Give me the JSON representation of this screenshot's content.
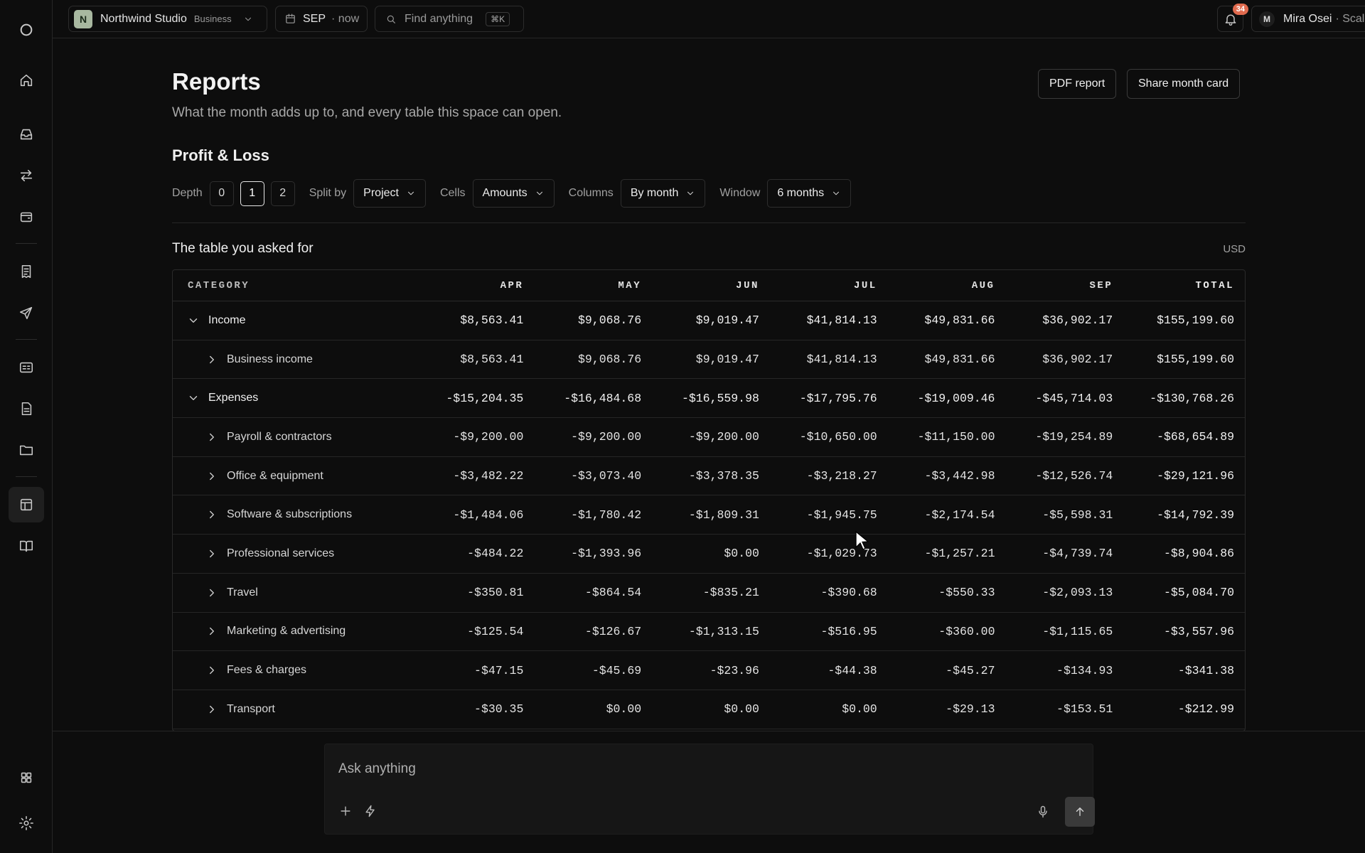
{
  "workspace": {
    "initial": "N",
    "name": "Northwind Studio",
    "plan": "Business"
  },
  "period": {
    "month": "SEP",
    "suffix": "· now"
  },
  "search": {
    "placeholder": "Find anything",
    "shortcut": "⌘K"
  },
  "notifications": {
    "count": "34"
  },
  "user": {
    "initial": "M",
    "name": "Mira Osei",
    "plan_suffix": "· Scale"
  },
  "rail": {
    "icons": [
      "logo-icon",
      "home-icon",
      "inbox-icon",
      "transfers-icon",
      "wallet-icon",
      "receipt-icon",
      "send-icon",
      "contacts-card-icon",
      "document-icon",
      "folder-icon",
      "table-icon",
      "book-icon",
      "apps-grid-icon",
      "settings-icon"
    ],
    "active": "table-icon"
  },
  "page": {
    "title": "Reports",
    "subtitle": "What the month adds up to, and every table this space can open.",
    "pdf_button": "PDF report",
    "share_button": "Share month card"
  },
  "pnl": {
    "title": "Profit & Loss",
    "depth_label": "Depth",
    "depth_options": [
      "0",
      "1",
      "2"
    ],
    "depth_selected": "1",
    "split_label": "Split by",
    "split_value": "Project",
    "cells_label": "Cells",
    "cells_value": "Amounts",
    "columns_label": "Columns",
    "columns_value": "By month",
    "window_label": "Window",
    "window_value": "6 months"
  },
  "table": {
    "title": "The table you asked for",
    "currency": "USD",
    "headers": [
      "CATEGORY",
      "APR",
      "MAY",
      "JUN",
      "JUL",
      "AUG",
      "SEP",
      "TOTAL"
    ],
    "rows": [
      {
        "label": "Income",
        "type": "group",
        "values": [
          "$8,563.41",
          "$9,068.76",
          "$9,019.47",
          "$41,814.13",
          "$49,831.66",
          "$36,902.17"
        ],
        "total": "$155,199.60"
      },
      {
        "label": "Business income",
        "type": "child",
        "values": [
          "$8,563.41",
          "$9,068.76",
          "$9,019.47",
          "$41,814.13",
          "$49,831.66",
          "$36,902.17"
        ],
        "total": "$155,199.60"
      },
      {
        "label": "Expenses",
        "type": "group",
        "values": [
          "-$15,204.35",
          "-$16,484.68",
          "-$16,559.98",
          "-$17,795.76",
          "-$19,009.46",
          "-$45,714.03"
        ],
        "total": "-$130,768.26"
      },
      {
        "label": "Payroll & contractors",
        "type": "child",
        "values": [
          "-$9,200.00",
          "-$9,200.00",
          "-$9,200.00",
          "-$10,650.00",
          "-$11,150.00",
          "-$19,254.89"
        ],
        "total": "-$68,654.89"
      },
      {
        "label": "Office & equipment",
        "type": "child",
        "values": [
          "-$3,482.22",
          "-$3,073.40",
          "-$3,378.35",
          "-$3,218.27",
          "-$3,442.98",
          "-$12,526.74"
        ],
        "total": "-$29,121.96"
      },
      {
        "label": "Software & subscriptions",
        "type": "child",
        "values": [
          "-$1,484.06",
          "-$1,780.42",
          "-$1,809.31",
          "-$1,945.75",
          "-$2,174.54",
          "-$5,598.31"
        ],
        "total": "-$14,792.39"
      },
      {
        "label": "Professional services",
        "type": "child",
        "values": [
          "-$484.22",
          "-$1,393.96",
          "$0.00",
          "-$1,029.73",
          "-$1,257.21",
          "-$4,739.74"
        ],
        "total": "-$8,904.86"
      },
      {
        "label": "Travel",
        "type": "child",
        "values": [
          "-$350.81",
          "-$864.54",
          "-$835.21",
          "-$390.68",
          "-$550.33",
          "-$2,093.13"
        ],
        "total": "-$5,084.70"
      },
      {
        "label": "Marketing & advertising",
        "type": "child",
        "values": [
          "-$125.54",
          "-$126.67",
          "-$1,313.15",
          "-$516.95",
          "-$360.00",
          "-$1,115.65"
        ],
        "total": "-$3,557.96"
      },
      {
        "label": "Fees & charges",
        "type": "child",
        "values": [
          "-$47.15",
          "-$45.69",
          "-$23.96",
          "-$44.38",
          "-$45.27",
          "-$134.93"
        ],
        "total": "-$341.38"
      },
      {
        "label": "Transport",
        "type": "child",
        "values": [
          "-$30.35",
          "$0.00",
          "$0.00",
          "$0.00",
          "-$29.13",
          "-$153.51"
        ],
        "total": "-$212.99"
      }
    ]
  },
  "chat": {
    "placeholder": "Ask anything"
  },
  "colors": {
    "background": "#0d0d0d",
    "accent_badge": "#e06a4e",
    "workspace_badge": "#a8b8a0"
  }
}
